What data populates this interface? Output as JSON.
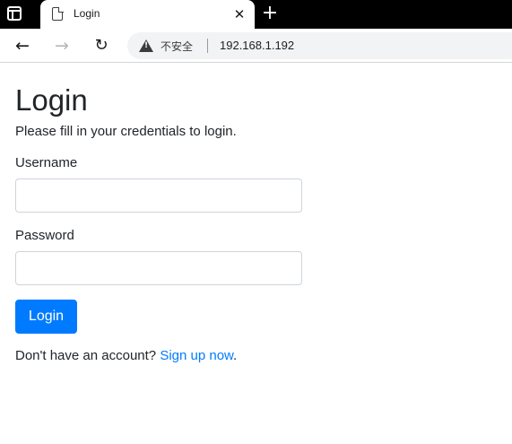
{
  "browser": {
    "tab": {
      "title": "Login",
      "close_glyph": "✕",
      "favicon": "page-icon"
    },
    "new_tab_glyph": "+",
    "nav": {
      "back_glyph": "←",
      "forward_glyph": "→",
      "reload_glyph": "↻"
    },
    "omnibox": {
      "security_icon": "warning-icon",
      "security_label": "不安全",
      "url": "192.168.1.192"
    }
  },
  "page": {
    "title": "Login",
    "subtitle": "Please fill in your credentials to login.",
    "username_label": "Username",
    "username_value": "",
    "password_label": "Password",
    "password_value": "",
    "login_button": "Login",
    "signup_prefix": "Don't have an account? ",
    "signup_link": "Sign up now",
    "signup_suffix": "."
  },
  "colors": {
    "accent": "#007bff",
    "text": "#212529",
    "input_border": "#ced4da",
    "tabstrip": "#000000"
  }
}
